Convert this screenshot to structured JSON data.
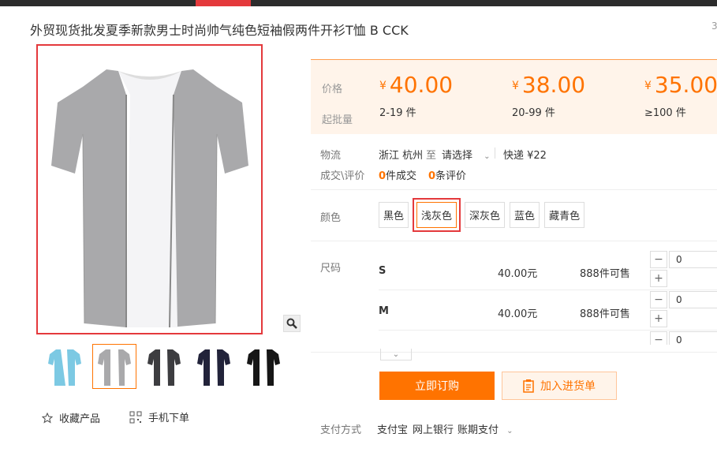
{
  "product": {
    "title": "外贸现货批发夏季新款男士时尚帅气纯色短袖假两件开衫T恤 B CCK",
    "more": "3"
  },
  "pricing": {
    "price_label": "价格",
    "qty_label": "起批量",
    "currency": "¥",
    "tiers": [
      {
        "price": "40.00",
        "range": "2-19 件"
      },
      {
        "price": "38.00",
        "range": "20-99 件"
      },
      {
        "price": "35.00",
        "range": "≥100 件"
      }
    ]
  },
  "shipping": {
    "label": "物流",
    "from": "浙江 杭州",
    "to_label": "至",
    "to_value": "请选择",
    "method": "快递 ¥22"
  },
  "transactions": {
    "label": "成交\\评价",
    "deals_count": "0",
    "deals_text": "件成交",
    "reviews_count": "0",
    "reviews_text": "条评价"
  },
  "color": {
    "label": "颜色",
    "options": [
      "黑色",
      "浅灰色",
      "深灰色",
      "蓝色",
      "藏青色"
    ],
    "selected": "浅灰色"
  },
  "sizes": {
    "label": "尺码",
    "rows": [
      {
        "name": "S",
        "price": "40.00元",
        "stock": "888件可售",
        "qty": "0"
      },
      {
        "name": "M",
        "price": "40.00元",
        "stock": "888件可售",
        "qty": "0"
      },
      {
        "name": "",
        "price": "",
        "stock": "",
        "qty": "0"
      }
    ]
  },
  "actions": {
    "order_label": "立即订购",
    "cart_label": "加入进货单",
    "favorite_label": "收藏产品",
    "mobile_label": "手机下单"
  },
  "payment": {
    "label": "支付方式",
    "methods": [
      "支付宝",
      "网上银行",
      "账期支付"
    ]
  },
  "colors": {
    "accent": "#ff7300",
    "highlight": "#e4393c",
    "price_bg": "#fff4ea"
  },
  "thumbnails": [
    "light-blue",
    "light-gray",
    "dark-gray",
    "navy",
    "black"
  ]
}
